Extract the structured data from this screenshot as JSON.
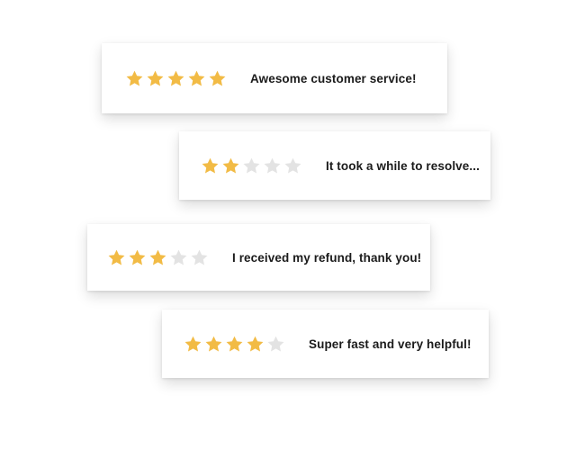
{
  "colors": {
    "star_filled": "#F2BB45",
    "star_empty": "#E3E3E3",
    "text": "#1b1b1b",
    "card_bg": "#ffffff"
  },
  "icons": {
    "star": "star-icon"
  },
  "reviews": [
    {
      "rating": 5,
      "max_rating": 5,
      "text": "Awesome customer service!"
    },
    {
      "rating": 2,
      "max_rating": 5,
      "text": "It took a while to resolve..."
    },
    {
      "rating": 3,
      "max_rating": 5,
      "text": "I received my refund, thank you!"
    },
    {
      "rating": 4,
      "max_rating": 5,
      "text": "Super fast and very helpful!"
    }
  ]
}
